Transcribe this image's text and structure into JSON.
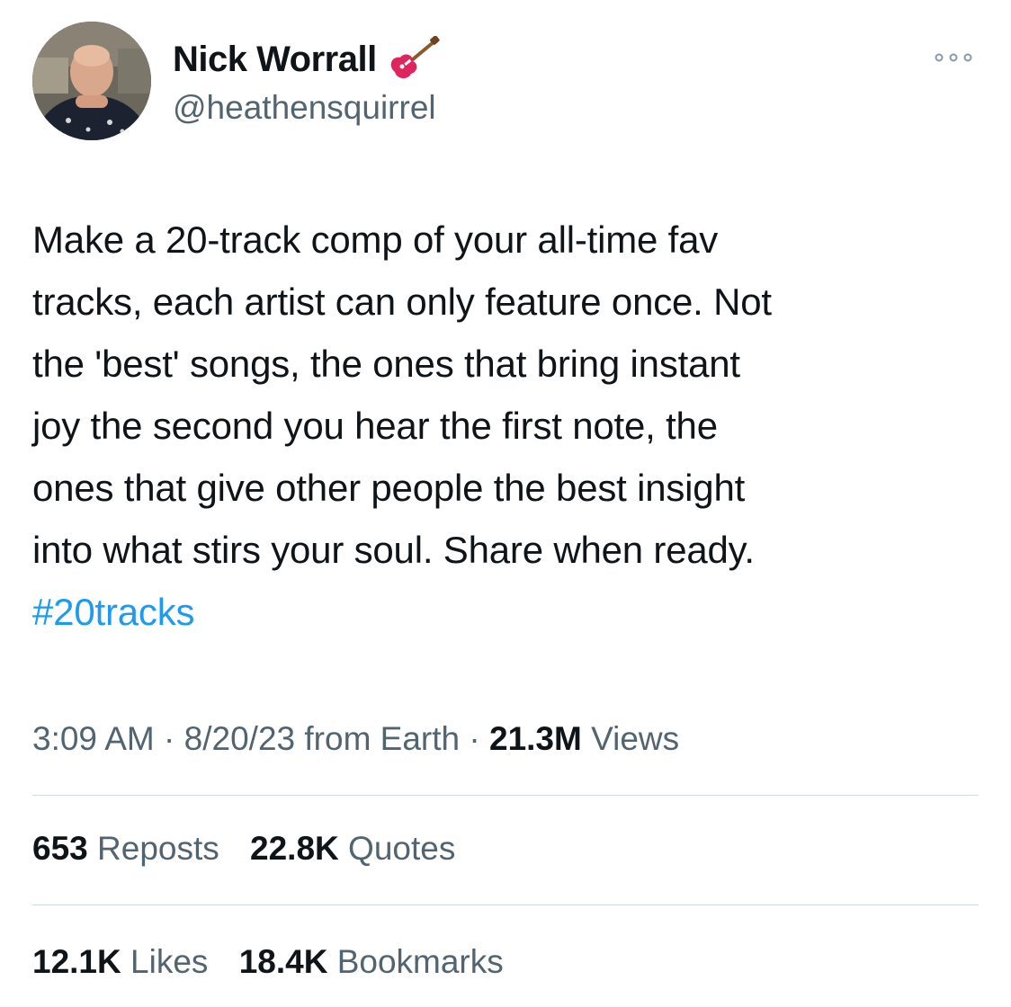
{
  "author": {
    "display_name": "Nick Worrall",
    "handle": "@heathensquirrel",
    "name_emoji": "electric-guitar-icon",
    "avatar": "avatar"
  },
  "tweet": {
    "lines": [
      "Make a 20-track comp of your all-time fav",
      "tracks, each artist can only feature once. Not",
      "the 'best' songs, the ones that bring instant",
      "joy the second you hear the first note, the",
      "ones that give other people the best insight",
      "into what stirs your soul. Share when ready."
    ],
    "hashtag": "#20tracks"
  },
  "meta": {
    "time": "3:09 AM",
    "sep1": " · ",
    "date": "8/20/23",
    "source": " from Earth",
    "sep2": " · ",
    "views_count": "21.3M",
    "views_label": " Views"
  },
  "stats_row1": [
    {
      "count": "653",
      "label": "Reposts"
    },
    {
      "count": "22.8K",
      "label": "Quotes"
    }
  ],
  "stats_row2": [
    {
      "count": "12.1K",
      "label": "Likes"
    },
    {
      "count": "18.4K",
      "label": "Bookmarks"
    }
  ],
  "colors": {
    "text": "#0f1419",
    "secondary": "#536471",
    "link": "#1d9bf0",
    "divider": "#cfd9de"
  }
}
